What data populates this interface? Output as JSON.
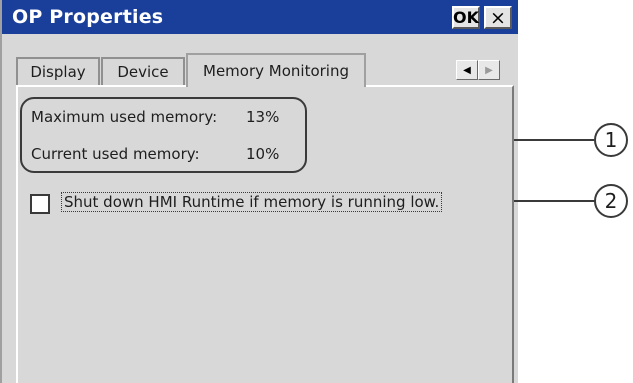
{
  "window": {
    "title": "OP Properties",
    "ok_label": "OK",
    "close_glyph": "×"
  },
  "tabs": [
    {
      "label": "Display",
      "active": false
    },
    {
      "label": "Device",
      "active": false
    },
    {
      "label": "Memory Monitoring",
      "active": true
    }
  ],
  "tab_scroll": {
    "left_glyph": "◀",
    "right_glyph": "▶"
  },
  "memory": {
    "max_label": "Maximum used memory:",
    "max_value": "13%",
    "current_label": "Current used memory:",
    "current_value": "10%"
  },
  "shutdown_option": {
    "label": "Shut down HMI Runtime if memory is running low.",
    "checked": false
  },
  "callouts": [
    "1",
    "2"
  ],
  "colors": {
    "titlebar": "#1a3f9a",
    "dialog_bg": "#d8d8d8"
  }
}
